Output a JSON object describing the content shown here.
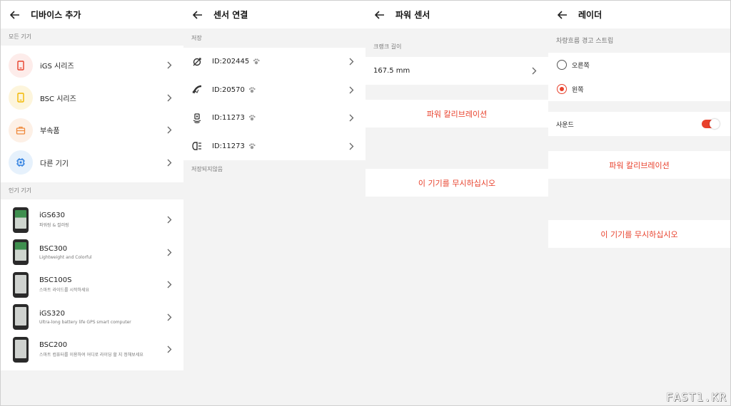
{
  "panel_add_device": {
    "title": "디바이스 추가",
    "section_all": "모든 기기",
    "devices": [
      {
        "label": "iGS 시리즈",
        "icon": "phone-device-icon",
        "color": "#e8412c",
        "bg": "#fdecea"
      },
      {
        "label": "BSC 시리즈",
        "icon": "phone-device-icon",
        "color": "#f2b800",
        "bg": "#fdf5dc"
      },
      {
        "label": "부속품",
        "icon": "toolbox-icon",
        "color": "#f08a3c",
        "bg": "#fdf0e6"
      },
      {
        "label": "다른 기기",
        "icon": "chip-icon",
        "color": "#2b7de0",
        "bg": "#e6f1fc"
      }
    ],
    "section_popular": "인기 기기",
    "popular": [
      {
        "name": "iGS630",
        "sub": "파워링 & 컬러링"
      },
      {
        "name": "BSC300",
        "sub": "Lightweight and Colorful"
      },
      {
        "name": "BSC100S",
        "sub": "스마트 라이드를 시작하세요"
      },
      {
        "name": "iGS320",
        "sub": "Ultra-long battery life GPS smart computer"
      },
      {
        "name": "BSC200",
        "sub": "스마트 컴퓨터를 이용하여 어디로 라이딩 할 지 정해보세요"
      }
    ]
  },
  "panel_sensor": {
    "title": "센서 연결",
    "section_saved": "저장",
    "sensors": [
      {
        "id": "ID:202445",
        "icon": "cadence-sensor-icon"
      },
      {
        "id": "ID:20570",
        "icon": "heart-rate-sensor-icon"
      },
      {
        "id": "ID:11273",
        "icon": "radar-sensor-icon"
      },
      {
        "id": "ID:11273",
        "icon": "light-sensor-icon"
      }
    ],
    "section_unsaved": "저장되지않음"
  },
  "panel_power": {
    "title": "파워 센서",
    "crank_label": "크랭크 길이",
    "crank_value": "167.5 mm",
    "calibration": "파워 칼리브레이션",
    "ignore": "이 기기를 무시하십시오"
  },
  "panel_radar": {
    "title": "레이더",
    "strip_label": "차량흐름 경고 스트립",
    "right": "오른쪽",
    "left": "왼쪽",
    "selected": "왼쪽",
    "sound": "사운드",
    "sound_on": true,
    "calibration": "파워 칼리브레이션",
    "ignore": "이 기기를 무시하십시오"
  },
  "watermark": "FAST1.KR",
  "accent": "#e8412c"
}
